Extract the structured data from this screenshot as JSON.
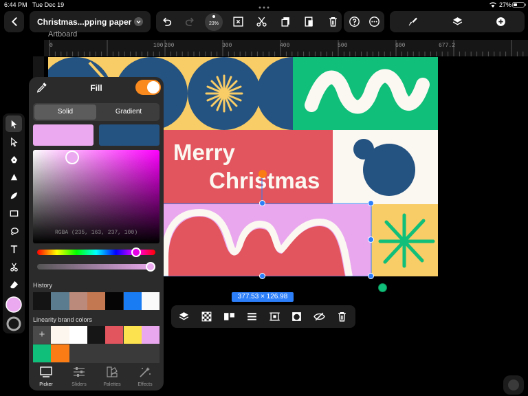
{
  "status_bar": {
    "time": "6:44 PM",
    "date": "Tue Dec 19",
    "battery": "27%"
  },
  "toolbar": {
    "doc_title": "Christmas...pping paper",
    "zoom": "23%"
  },
  "canvas": {
    "artboard_label": "Artboard",
    "ruler_ticks": [
      "0",
      "100",
      "200",
      "300",
      "400",
      "500",
      "600",
      "677.2"
    ],
    "artwork_text_line1": "Merry",
    "artwork_text_line2": "Christmas",
    "selection_size": "377.53 × 126.98",
    "colors": {
      "navy": "#245281",
      "green": "#10bf79",
      "yellow": "#f8cc66",
      "red": "#e2545e",
      "pink": "#e9a8ee",
      "cream": "#fbf8f2",
      "selection": "#2d7ff9"
    }
  },
  "fill_panel": {
    "title": "Fill",
    "mode_solid": "Solid",
    "mode_gradient": "Gradient",
    "rgba_readout": "RGBA (235, 163, 237, 100)",
    "current_color": "#ebaaef",
    "previous_color": "#245281",
    "history_label": "History",
    "history_colors": [
      "#141414",
      "#5a7c8e",
      "#bc8a7a",
      "#c47852",
      "#050505",
      "#197cf2",
      "#fafafa"
    ],
    "brand_label": "Linearity brand colors",
    "add_label": "+",
    "brand_colors": [
      "#fcf6ee",
      "#ffffff",
      "#161616",
      "#e2545e",
      "#fde24f",
      "#e9a8ee",
      "#10bf79",
      "#fa7c14"
    ]
  },
  "panel_tabs": [
    {
      "label": "Picker",
      "icon": "picker-icon"
    },
    {
      "label": "Sliders",
      "icon": "sliders-icon"
    },
    {
      "label": "Palettes",
      "icon": "palettes-icon"
    },
    {
      "label": "Effects",
      "icon": "effects-icon"
    }
  ]
}
